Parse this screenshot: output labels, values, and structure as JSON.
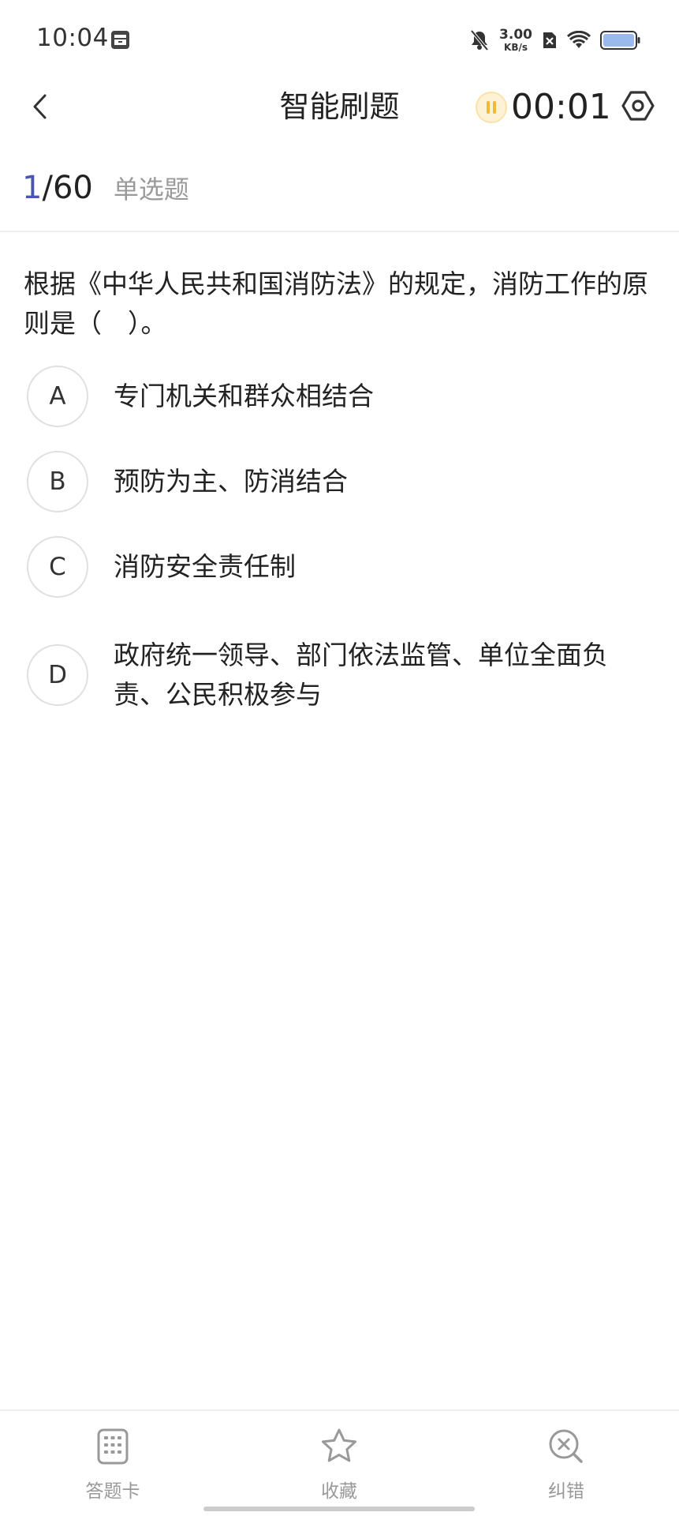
{
  "status_bar": {
    "time": "10:04",
    "net_speed_value": "3.00",
    "net_speed_unit": "KB/s",
    "icons": [
      "notification-icon",
      "bell-muted-icon",
      "sim-x-icon",
      "wifi-icon",
      "battery-icon"
    ]
  },
  "header": {
    "title": "智能刷题",
    "timer": "00:01",
    "accent_color": "#f5c242"
  },
  "progress": {
    "current": "1",
    "separator": "/",
    "total": "60",
    "question_type": "单选题",
    "current_color": "#4a55b0"
  },
  "question": {
    "text": "根据《中华人民共和国消防法》的规定，消防工作的原则是（　）。",
    "options": [
      {
        "letter": "A",
        "text": "专门机关和群众相结合"
      },
      {
        "letter": "B",
        "text": "预防为主、防消结合"
      },
      {
        "letter": "C",
        "text": "消防安全责任制"
      },
      {
        "letter": "D",
        "text": "政府统一领导、部门依法监管、单位全面负责、公民积极参与"
      }
    ]
  },
  "bottom_bar": {
    "items": [
      {
        "label": "答题卡",
        "icon": "answer-card-icon"
      },
      {
        "label": "收藏",
        "icon": "star-icon"
      },
      {
        "label": "纠错",
        "icon": "error-correct-icon"
      }
    ]
  }
}
